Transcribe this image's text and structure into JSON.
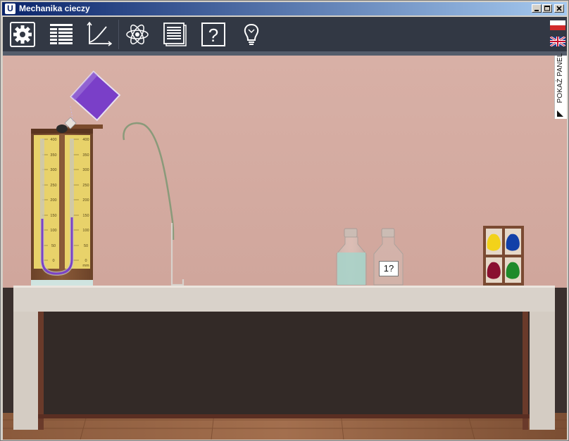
{
  "window": {
    "title": "Mechanika cieczy",
    "app_icon": "U",
    "controls": [
      "minimize-icon",
      "maximize-icon",
      "close-icon"
    ]
  },
  "toolbar": {
    "tools": [
      {
        "name": "settings",
        "icon": "gear-icon"
      },
      {
        "name": "table",
        "icon": "table-icon"
      },
      {
        "name": "graph",
        "icon": "graph-icon"
      },
      {
        "name": "atom",
        "icon": "atom-icon"
      },
      {
        "name": "notes",
        "icon": "document-icon"
      },
      {
        "name": "help",
        "icon": "question-icon",
        "glyph": "?"
      },
      {
        "name": "hint",
        "icon": "lightbulb-icon"
      }
    ],
    "languages": [
      "pl",
      "en"
    ]
  },
  "side_panel": {
    "label": "POKAŻ PANEL"
  },
  "manometer": {
    "scale_left": [
      "400",
      "350",
      "300",
      "250",
      "200",
      "150",
      "100",
      "50",
      "0"
    ],
    "scale_right": [
      "400",
      "350",
      "300",
      "250",
      "200",
      "150",
      "100",
      "50",
      "0"
    ],
    "unit": "mm"
  },
  "bottles": [
    {
      "name": "light-blue-liquid",
      "color": "#a9d3c9"
    },
    {
      "name": "unknown-liquid",
      "label": "1?"
    }
  ],
  "dye_box": {
    "colors": [
      "#f2d21a",
      "#1240a8",
      "#8a1030",
      "#1f8a2a"
    ]
  },
  "colors": {
    "wall": "#d4aaa1",
    "table_top": "#d8d1c8",
    "liquid_purple": "#7a42c8",
    "toolbar": "#323844",
    "title_gradient_start": "#0a246a"
  }
}
